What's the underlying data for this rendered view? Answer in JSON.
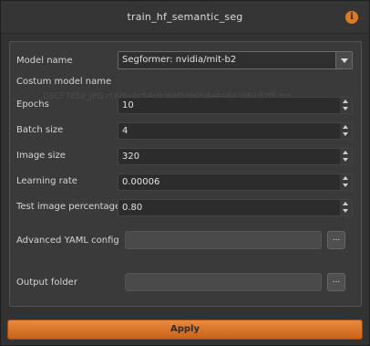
{
  "window": {
    "title": "train_hf_semantic_seg"
  },
  "icons": {
    "info": "info-icon",
    "combo_arrow": "chevron-down-icon"
  },
  "colors": {
    "accent": "#e07b1d",
    "apply_button": "#d9722a",
    "background": "#323232"
  },
  "form": {
    "model_name": {
      "label": "Model name",
      "value": "Segformer: nvidia/mit-b2"
    },
    "custom_model_name": {
      "label": "Costum model name",
      "ghost_text": "DSCF7850_JPG.rf.6f6c0c54c0c6bf50b0b6eba84299102f8.jpg"
    },
    "epochs": {
      "label": "Epochs",
      "value": "10"
    },
    "batch_size": {
      "label": "Batch size",
      "value": "4"
    },
    "image_size": {
      "label": "Image size",
      "value": "320"
    },
    "learning_rate": {
      "label": "Learning rate",
      "value": "0.00006"
    },
    "test_image_percentage": {
      "label": "Test image percentage",
      "value": "0.80"
    },
    "advanced_yaml": {
      "label": "Advanced YAML config",
      "value": "",
      "browse_label": "..."
    },
    "output_folder": {
      "label": "Output folder",
      "value": "",
      "browse_label": "..."
    }
  },
  "footer": {
    "apply_label": "Apply"
  }
}
